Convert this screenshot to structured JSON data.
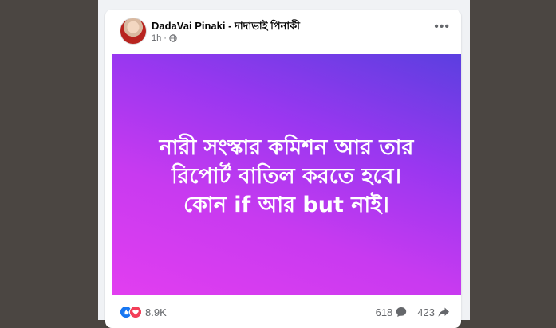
{
  "post": {
    "author": "DadaVai Pinaki - দাদাভাই পিনাকী",
    "time": "1h ·",
    "text_lines": [
      "নারী সংস্কার কমিশন আর তার",
      "রিপোর্ট বাতিল করতে হবে।",
      "কোন if আর but নাই।"
    ],
    "gradient_colors": [
      "#5b3fe0",
      "#9a37f0",
      "#e23ef0"
    ]
  },
  "footer": {
    "reaction_count": "8.9K",
    "comment_count": "618",
    "share_count": "423"
  },
  "icons": {
    "more": "more-options-icon",
    "audience": "globe-icon",
    "like": "like-icon",
    "love": "love-icon",
    "comment": "comment-icon",
    "share": "share-icon"
  }
}
